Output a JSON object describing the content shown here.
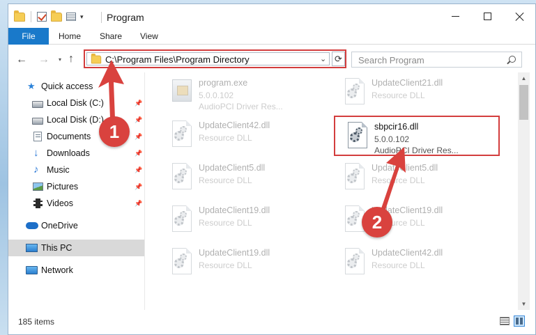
{
  "window": {
    "title": "Program",
    "controls": {
      "minimize": "minimize",
      "maximize": "maximize",
      "close": "close"
    }
  },
  "ribbon": {
    "tabs": [
      {
        "label": "File"
      },
      {
        "label": "Home"
      },
      {
        "label": "Share"
      },
      {
        "label": "View"
      }
    ]
  },
  "address_bar": {
    "path": "C:\\Program Files\\Program Directory",
    "search_placeholder": "Search Program"
  },
  "nav_pane": {
    "items": [
      {
        "label": "Quick access",
        "icon": "star-icon",
        "pinned": false
      },
      {
        "label": "Local Disk (C:)",
        "icon": "disk-icon",
        "pinned": true
      },
      {
        "label": "Local Disk (D:)",
        "icon": "disk-icon",
        "pinned": true
      },
      {
        "label": "Documents",
        "icon": "documents-icon",
        "pinned": true
      },
      {
        "label": "Downloads",
        "icon": "downloads-icon",
        "pinned": true
      },
      {
        "label": "Music",
        "icon": "music-icon",
        "pinned": true
      },
      {
        "label": "Pictures",
        "icon": "pictures-icon",
        "pinned": true
      },
      {
        "label": "Videos",
        "icon": "videos-icon",
        "pinned": true
      },
      {
        "label": "OneDrive",
        "icon": "onedrive-icon",
        "pinned": false
      },
      {
        "label": "This PC",
        "icon": "this-pc-icon",
        "pinned": false,
        "selected": true
      },
      {
        "label": "Network",
        "icon": "network-icon",
        "pinned": false
      }
    ]
  },
  "files": [
    {
      "name": "program.exe",
      "line2": "5.0.0.102",
      "line3": "AudioPCI Driver Res...",
      "type": "exe",
      "faded": true
    },
    {
      "name": "UpdateClient21.dll",
      "line2": "Resource DLL",
      "line3": "",
      "type": "dll",
      "faded": true
    },
    {
      "name": "UpdateClient42.dll",
      "line2": "Resource DLL",
      "line3": "",
      "type": "dll",
      "faded": true
    },
    {
      "name": "sbpcir16.dll",
      "line2": "5.0.0.102",
      "line3": "AudioPCI Driver Res...",
      "type": "dll",
      "faded": false,
      "selected": true
    },
    {
      "name": "UpdateClient5.dll",
      "line2": "Resource DLL",
      "line3": "",
      "type": "dll",
      "faded": true
    },
    {
      "name": "UpdateClient5.dll",
      "line2": "Resource DLL",
      "line3": "",
      "type": "dll",
      "faded": true
    },
    {
      "name": "UpdateClient19.dll",
      "line2": "Resource DLL",
      "line3": "",
      "type": "dll",
      "faded": true
    },
    {
      "name": "UpdateClient19.dll",
      "line2": "Resource DLL",
      "line3": "",
      "type": "dll",
      "faded": true
    },
    {
      "name": "UpdateClient19.dll",
      "line2": "Resource DLL",
      "line3": "",
      "type": "dll",
      "faded": true
    },
    {
      "name": "UpdateClient42.dll",
      "line2": "Resource DLL",
      "line3": "",
      "type": "dll",
      "faded": true
    }
  ],
  "status_bar": {
    "item_count": "185 items"
  },
  "callouts": [
    {
      "number": "1"
    },
    {
      "number": "2"
    }
  ],
  "colors": {
    "accent": "#1979ca",
    "highlight": "#d33d3d",
    "badge": "#d9423e"
  }
}
